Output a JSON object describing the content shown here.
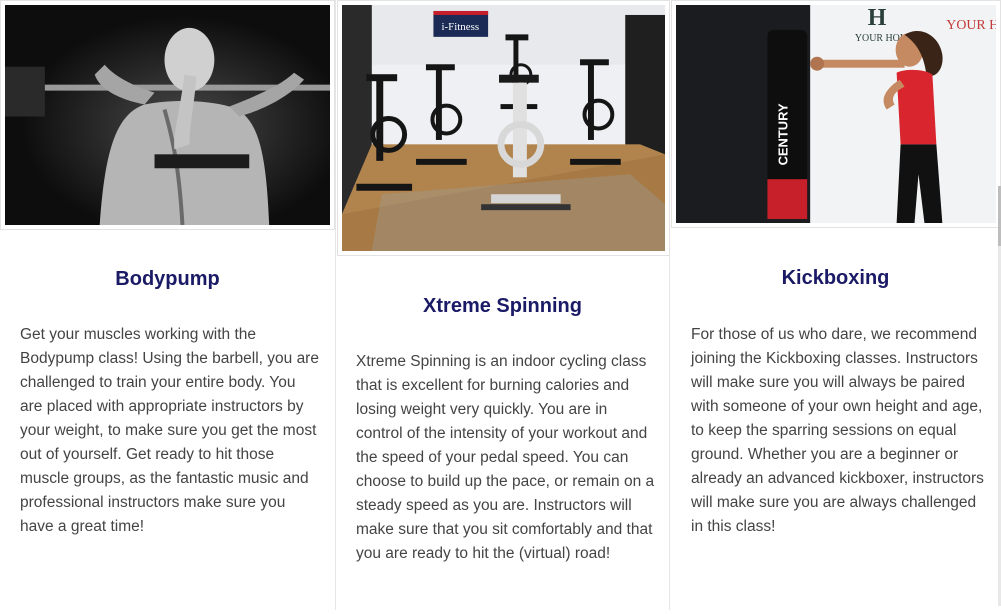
{
  "cards": [
    {
      "title": "Bodypump",
      "body": "Get your muscles working with the Bodypump class! Using the barbell, you are challenged to train your entire body. You are placed with appropriate instructors by your weight, to make sure you get the most out of yourself. Get ready to hit those muscle groups, as the fantastic music and professional instructors make sure you have a great time!"
    },
    {
      "title": "Xtreme Spinning",
      "image_sign": "i-Fitness",
      "body": "Xtreme Spinning is an indoor cycling class that is excellent for burning calories and losing weight very quickly. You are in control of the intensity of your workout and the speed of your pedal speed. You can choose to build up the pace, or remain on a steady speed as you are. Instructors will make sure that you sit comfortably and that you are ready to hit the (virtual) road!"
    },
    {
      "title": "Kickboxing",
      "image_bag_text": "CENTURY",
      "image_wall_text_1": "YOUR HOUSE",
      "image_wall_text_2": "YOUR H",
      "body": "For those of us who dare, we recommend joining the Kickboxing classes. Instructors will make sure you will always be paired with someone of your own height and age, to keep the sparring sessions on equal ground. Whether you are a beginner or already an advanced kickboxer, instructors will make sure you are always challenged in this class!"
    }
  ],
  "colors": {
    "title": "#1a1a66",
    "body_text": "#444444",
    "bag_red": "#c8202a"
  },
  "icons": [
    "bodypump-photo",
    "spinning-photo",
    "kickboxing-photo"
  ]
}
